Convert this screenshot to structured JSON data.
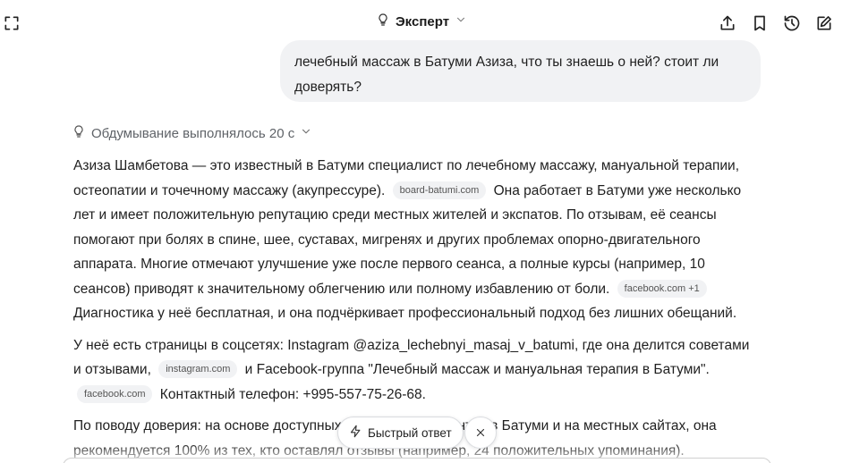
{
  "header": {
    "model_name": "Эксперт"
  },
  "icons": {
    "expand": "fullscreen-icon",
    "model": "lightbulb-icon",
    "model_chevron": "chevron-down-icon",
    "share": "share-icon",
    "bookmark": "bookmark-icon",
    "history": "history-icon",
    "edit": "edit-icon",
    "fast": "lightning-icon",
    "close": "close-icon"
  },
  "user_message": {
    "text": "лечебный массаж в Батуми Азиза, что ты знаешь о ней? стоит ли доверять?"
  },
  "thinking": {
    "label": "Обдумывание выполнялось 20 с"
  },
  "answer": {
    "p1_a": "Азиза Шамбетова — это известный в Батуми специалист по лечебному массажу, мануальной терапии, остеопатии и точечному массажу (акупрессуре).",
    "p1_src1": "board-batumi.com",
    "p1_b": "Она работает в Батуми уже несколько лет и имеет положительную репутацию среди местных жителей и экспатов. По отзывам, её сеансы помогают при болях в спине, шее, суставах, мигренях и других проблемах опорно-двигательного аппарата. Многие отмечают улучшение уже после первого сеанса, а полные курсы (например, 10 сеансов) приводят к значительному облегчению или полному избавлению от боли.",
    "p1_src2": "facebook.com +1",
    "p1_c": "Диагностика у неё бесплатная, и она подчёркивает профессиональный подход без лишних обещаний.",
    "p2_a": "У неё есть страницы в соцсетях: Instagram @aziza_lechebnyi_masaj_v_batumi, где она делится советами и отзывами,",
    "p2_src1": "instagram.com",
    "p2_b": "и Facebook-группа \"Лечебный массаж и мануальная терапия в Батуми\".",
    "p2_src2": "facebook.com",
    "p2_c": "Контактный телефон: +995-557-75-26-68.",
    "p3": "По поводу доверия: на основе доступных отзывов от пациентов в Батуми и на местных сайтах, она рекомендуется 100% из тех, кто оставлял отзывы (например, 24 положительных упоминания)."
  },
  "floating": {
    "fast_answer_label": "Быстрый ответ"
  }
}
